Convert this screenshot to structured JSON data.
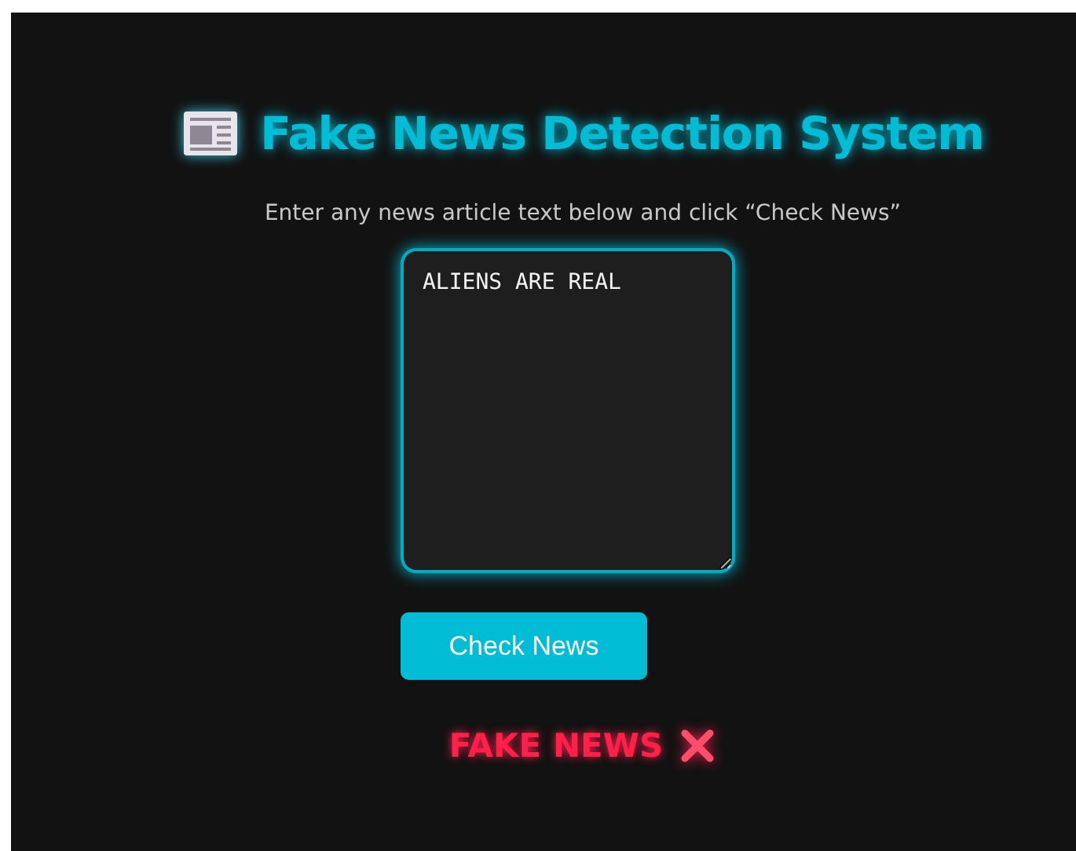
{
  "header": {
    "title": "Fake News Detection System"
  },
  "instructions": "Enter any news article text below and click “Check News”",
  "article_input": {
    "value": "ALIENS ARE REAL"
  },
  "check_button": {
    "label": "Check News"
  },
  "result": {
    "kind": "fake",
    "text": "FAKE NEWS"
  }
}
